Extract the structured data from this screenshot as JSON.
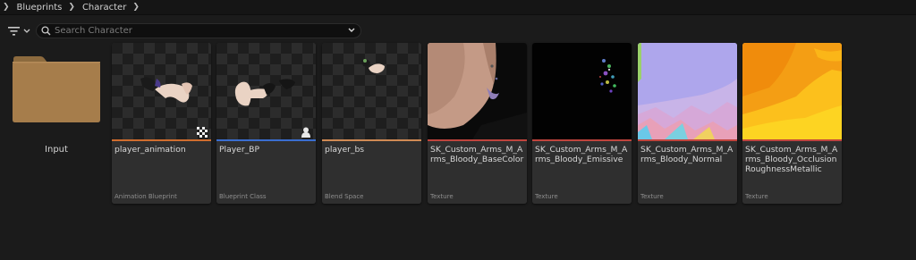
{
  "breadcrumb": {
    "items": [
      "Blueprints",
      "Character"
    ]
  },
  "search": {
    "placeholder": "Search Character",
    "value": ""
  },
  "folder": {
    "label": "Input"
  },
  "assets": [
    {
      "name": "player_animation",
      "type": "Animation Blueprint",
      "bar_color": "#d06d2e"
    },
    {
      "name": "Player_BP",
      "type": "Blueprint Class",
      "bar_color": "#3a6ed0"
    },
    {
      "name": "player_bs",
      "type": "Blend Space",
      "bar_color": "#d08a54"
    },
    {
      "name": "SK_Custom_Arms_M_Arms_Bloody_BaseColor",
      "type": "Texture",
      "bar_color": "#c0443d"
    },
    {
      "name": "SK_Custom_Arms_M_Arms_Bloody_Emissive",
      "type": "Texture",
      "bar_color": "#c0443d"
    },
    {
      "name": "SK_Custom_Arms_M_Arms_Bloody_Normal",
      "type": "Texture",
      "bar_color": "#c0443d"
    },
    {
      "name": "SK_Custom_Arms_M_Arms_Bloody_Occlusion RoughnessMetallic",
      "type": "Texture",
      "bar_color": "#c0443d"
    }
  ],
  "icons": {
    "filter": "filter-icon",
    "search": "search-icon",
    "dropdown": "chevron-down-icon",
    "folder": "folder-icon"
  }
}
